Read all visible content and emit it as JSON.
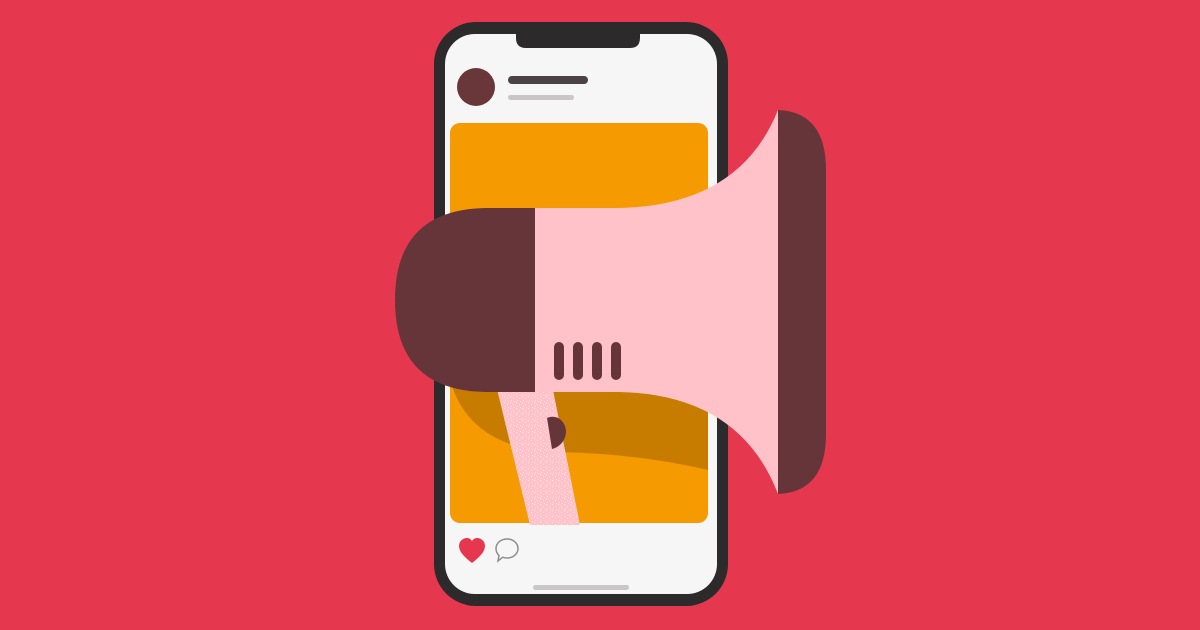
{
  "palette": {
    "background": "#e5384f",
    "phone_frame": "#2c2a2b",
    "phone_screen": "#f7f6f6",
    "avatar": "#693639",
    "username_bar": "#4a4244",
    "subtitle_bar": "#c8c6c7",
    "post_image": "#f59a00",
    "post_shadow": "#c77c00",
    "megaphone_body": "#ffc2c8",
    "megaphone_dark": "#663539",
    "heart": "#e5384f",
    "comment_outline": "#8f8c8d",
    "home_indicator": "#c8c6c7"
  },
  "icons": {
    "like": "heart-icon",
    "comment": "comment-bubble-icon",
    "megaphone": "megaphone-icon",
    "avatar": "avatar-icon"
  },
  "post": {
    "liked": true
  }
}
